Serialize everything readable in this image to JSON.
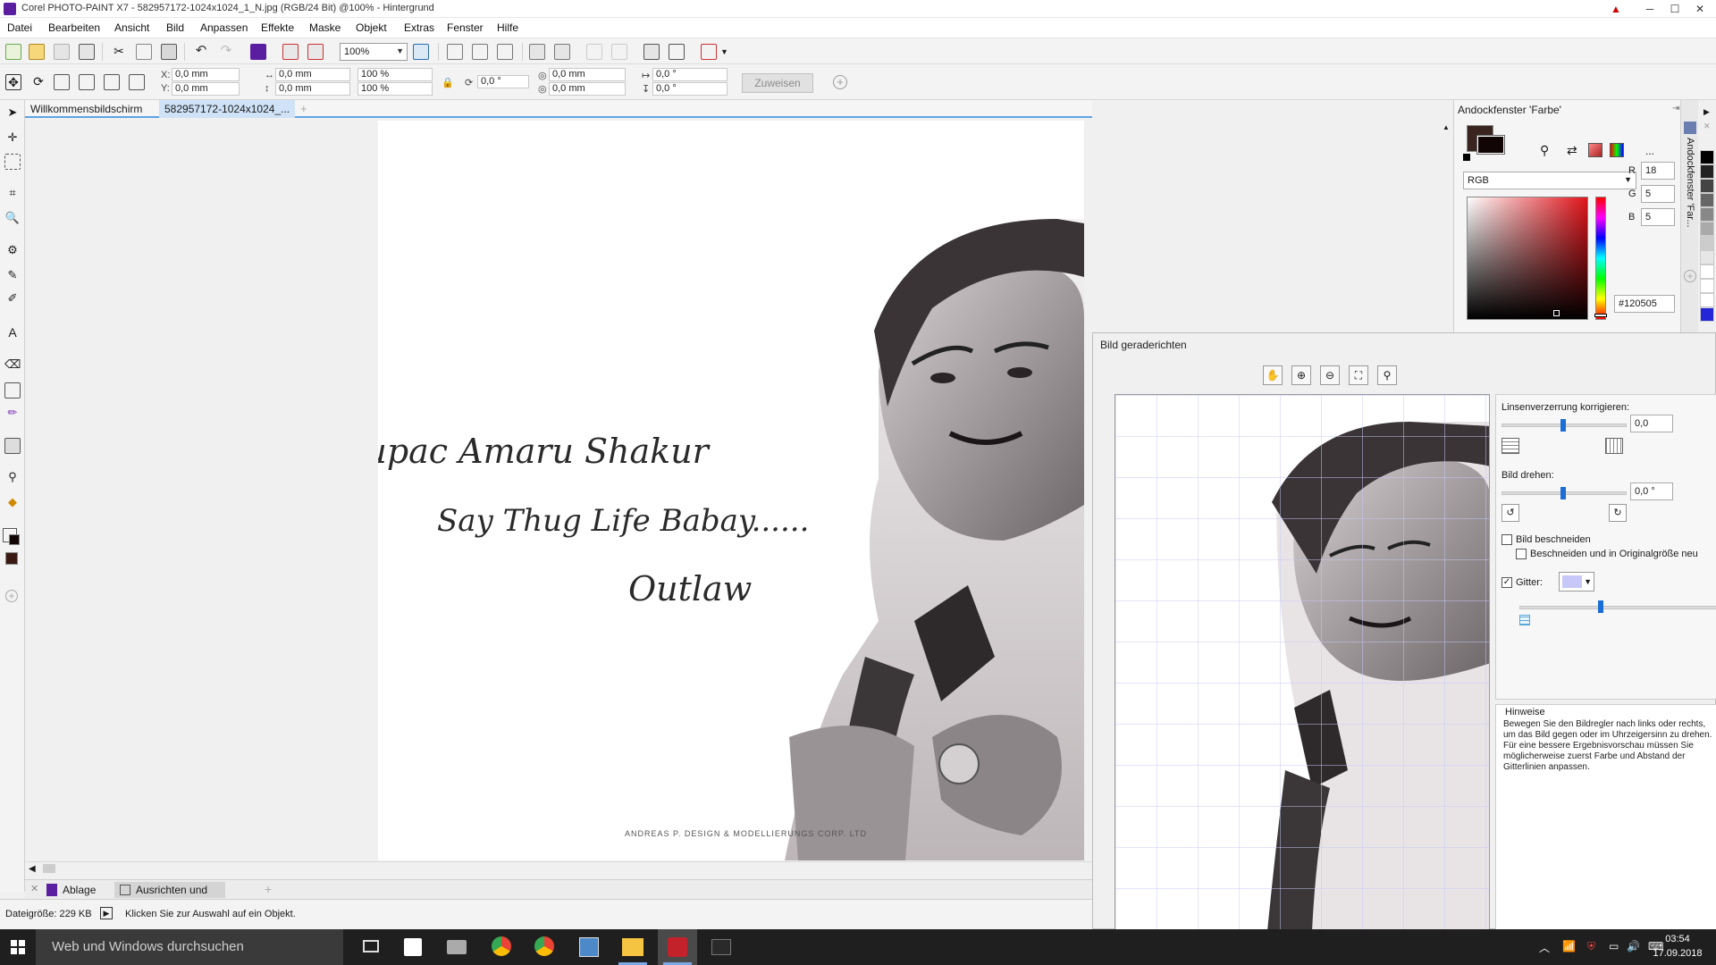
{
  "app": {
    "title": "Corel PHOTO-PAINT X7 - 582957172-1024x1024_1_N.jpg (RGB/24 Bit) @100% - Hintergrund"
  },
  "window_controls": {
    "minimize": "─",
    "maximize": "☐",
    "close": "✕"
  },
  "menu": [
    "Datei",
    "Bearbeiten",
    "Ansicht",
    "Bild",
    "Anpassen",
    "Effekte",
    "Maske",
    "Objekt",
    "Extras",
    "Fenster",
    "Hilfe"
  ],
  "toolbar": {
    "zoom": "100%"
  },
  "propbar": {
    "x_label": "X:",
    "y_label": "Y:",
    "x": "0,0 mm",
    "y": "0,0 mm",
    "w": "0,0 mm",
    "h": "0,0 mm",
    "scale_w": "100 %",
    "scale_h": "100 %",
    "rotate": "0,0 °",
    "cx": "0,0 mm",
    "cy": "0,0 mm",
    "skew_h": "0,0 °",
    "skew_v": "0,0 °",
    "apply": "Zuweisen"
  },
  "doc_tabs": [
    "Willkommensbildschirm",
    "582957172-1024x1024_..."
  ],
  "canvas": {
    "line1": "Tupac Amaru Shakur",
    "line2": "Say Thug Life Babay......",
    "line3": "Outlaw",
    "credit": "ANDREAS P. DESIGN & MODELLIERUNGS CORP. LTD"
  },
  "bottom_dock_tabs": [
    "Ablage",
    "Ausrichten und ve..."
  ],
  "status": {
    "filesize": "Dateigröße: 229 KB",
    "hint": "Klicken Sie zur Auswahl auf ein Objekt."
  },
  "color_dock": {
    "title": "Andockfenster 'Farbe'",
    "side_title": "Andockfenster 'Far...",
    "model": "RGB",
    "r_label": "R",
    "g_label": "G",
    "b_label": "B",
    "r": "18",
    "g": "5",
    "b": "5",
    "hex": "#120505",
    "more": "...",
    "colors": {
      "primary": "#120505",
      "secondary": "#1a0a08"
    }
  },
  "straighten": {
    "title": "Bild geraderichten",
    "lens_label": "Linsenverzerrung korrigieren:",
    "lens_value": "0,0",
    "rotate_label": "Bild drehen:",
    "rotate_value": "0,0 °",
    "crop_label": "Bild beschneiden",
    "crop_resize_label": "Beschneiden und in Originalgröße neu",
    "grid_label": "Gitter:",
    "hints_title": "Hinweise",
    "hints_text": "Bewegen Sie den Bildregler nach links oder rechts, um das Bild gegen oder im Uhrzeigersinn zu drehen. Für eine bessere Ergebnisvorschau müssen Sie möglicherweise zuerst Farbe und Abstand der Gitterlinien anpassen.",
    "grid_color": "#c8c8f8"
  },
  "taskbar": {
    "search_placeholder": "Web und Windows durchsuchen",
    "time": "03:54",
    "date": "17.09.2018"
  }
}
